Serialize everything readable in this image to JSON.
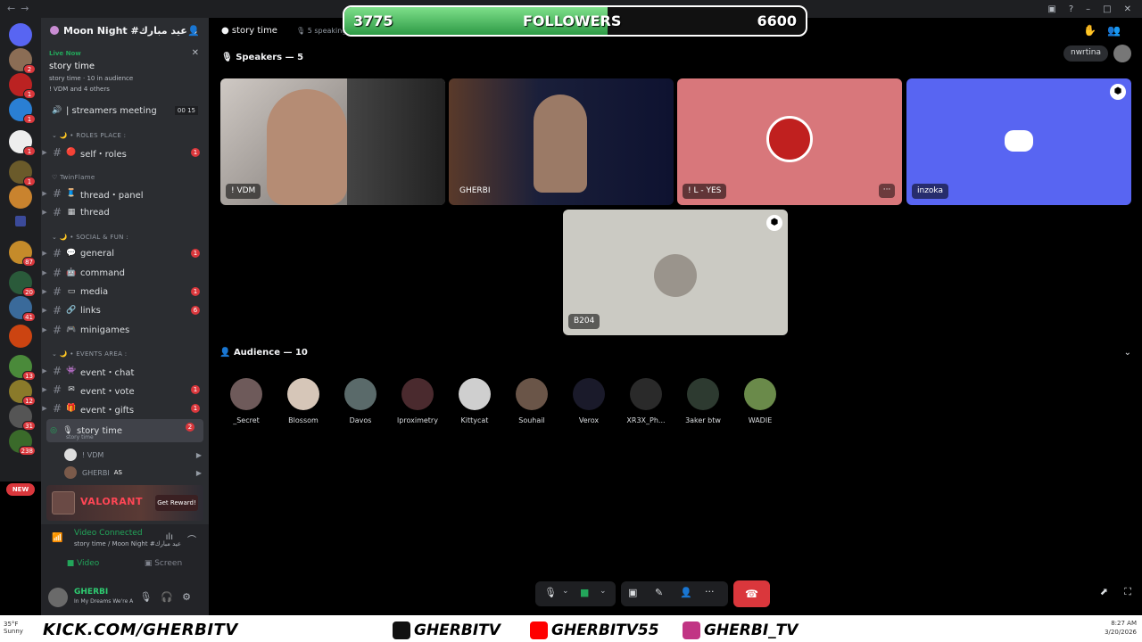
{
  "server": {
    "name": "Moon Night #عيد مبارك"
  },
  "live": {
    "label": "Live Now",
    "title": "story time",
    "stage": "story time",
    "audience": "10 in audience",
    "people": "! VDM and 4 others"
  },
  "channels": {
    "streamers": {
      "name": "| streamers meeting",
      "c1": "00",
      "c2": "15"
    },
    "cat_roles": "ROLES PLACE :",
    "self_roles": {
      "name": "self・roles",
      "badge": "1"
    },
    "cat_twin": "TwinFlame",
    "thread_panel": "thread・panel",
    "thread": "thread",
    "cat_social": "SOCIAL & FUN :",
    "general": {
      "name": "general",
      "badge": "1"
    },
    "command": "command",
    "media": {
      "name": "media",
      "badge": "1"
    },
    "links": {
      "name": "links",
      "badge": "6"
    },
    "minigames": "minigames",
    "cat_events": "EVENTS AREA :",
    "event_chat": "event・chat",
    "event_vote": {
      "name": "event・vote",
      "badge": "1"
    },
    "event_gifts": {
      "name": "event・gifts",
      "badge": "1"
    },
    "story": {
      "name": "story time",
      "sub": "story time",
      "badge": "2"
    },
    "member1": "! VDM",
    "member2": "GHERBI",
    "member2_tag": "AS"
  },
  "rail_badges": [
    "2",
    "1",
    "1",
    "1",
    "1",
    "87",
    "20",
    "41",
    "13",
    "12",
    "31",
    "238"
  ],
  "new_label": "NEW",
  "valorant": {
    "name": "VALORANT",
    "button": "Get Reward!"
  },
  "voice": {
    "status": "Video Connected",
    "sub": "story time / Moon Night #عيد مبارك",
    "video": "Video",
    "screen": "Screen"
  },
  "user": {
    "name": "GHERBI",
    "status": "In My Dreams We're A"
  },
  "header": {
    "title": "story time",
    "speaking": "5 speaking"
  },
  "nwrtina": "nwrtina",
  "speakers_label": "Speakers — 5",
  "speakers": [
    "! VDM",
    "GHERBI",
    "! L - YES",
    "inzoka",
    "B204"
  ],
  "audience_label": "Audience — 10",
  "audience": [
    "_Secret",
    "Blossom",
    "Davos",
    "lproximetry",
    "Kittycat",
    "Souhail",
    "Verox",
    "XR3X_Ph...",
    "3aker btw",
    "WADIE"
  ],
  "followers": {
    "current": "3775",
    "label": "FOLLOWERS",
    "goal": "6600",
    "progress": 0.57
  },
  "overlay": {
    "kick": "KICK.COM/GHERBITV",
    "twitch": "GHERBITV",
    "youtube": "GHERBITV55",
    "instagram": "GHERBI_TV",
    "weather": "35°F",
    "weather2": "Sunny",
    "time": "8:27 AM",
    "date": "3/20/2026"
  },
  "colors": {
    "accent": "#5865f2",
    "danger": "#da373c",
    "online": "#23a55a",
    "pinkTile": "#d8777b"
  }
}
